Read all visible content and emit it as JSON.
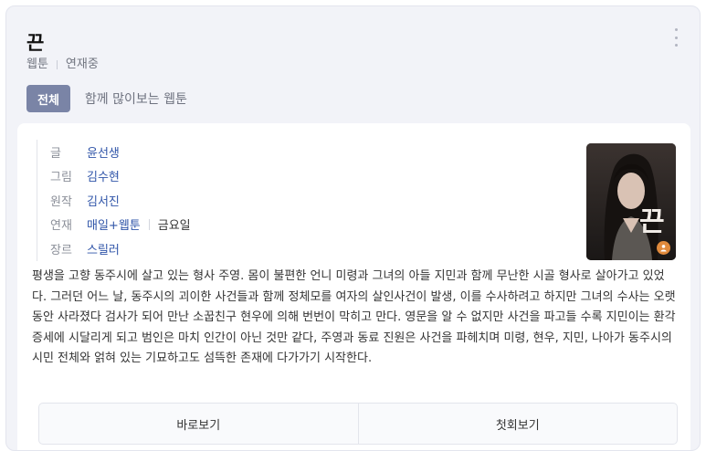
{
  "header": {
    "title": "끈",
    "category": "웹툰",
    "status": "연재중"
  },
  "tabs": {
    "active_label": "전체",
    "other_label": "함께 많이보는 웹툰"
  },
  "info": {
    "writer_label": "글",
    "writer": "윤선생",
    "artist_label": "그림",
    "artist": "김수현",
    "original_label": "원작",
    "original": "김서진",
    "serial_label": "연재",
    "serial_platform": "매일+웹툰",
    "serial_day": "금요일",
    "genre_label": "장르",
    "genre": "스릴러"
  },
  "cover": {
    "title_glyph": "끈",
    "icon": "person-badge-icon",
    "colors": {
      "background": "#2a2522",
      "badge": "#e08a3c"
    }
  },
  "description": "평생을 고향 동주시에 살고 있는 형사 주영. 몸이 불편한 언니 미령과 그녀의 아들 지민과 함께 무난한 시골 형사로 살아가고 있었다. 그러던 어느 날, 동주시의 괴이한 사건들과 함께 정체모를 여자의 살인사건이 발생, 이를 수사하려고 하지만 그녀의 수사는 오랫동안 사라졌다 검사가 되어 만난 소꿉친구 현우에 의해 번번이 막히고 만다. 영문을 알 수 없지만 사건을 파고들 수록 지민이는 환각 증세에 시달리게 되고 범인은 마치 인간이 아닌 것만 같다, 주영과 동료 진원은 사건을 파헤치며 미령, 현우, 지민, 나아가 동주시의 시민 전체와 얽혀 있는 기묘하고도 섬뜩한 존재에 다가가기 시작한다.",
  "actions": {
    "read_now": "바로보기",
    "first_episode": "첫회보기"
  },
  "colors": {
    "accent": "#7a84a6",
    "link": "#2f54a8",
    "card_bg": "#f2f3f8"
  }
}
